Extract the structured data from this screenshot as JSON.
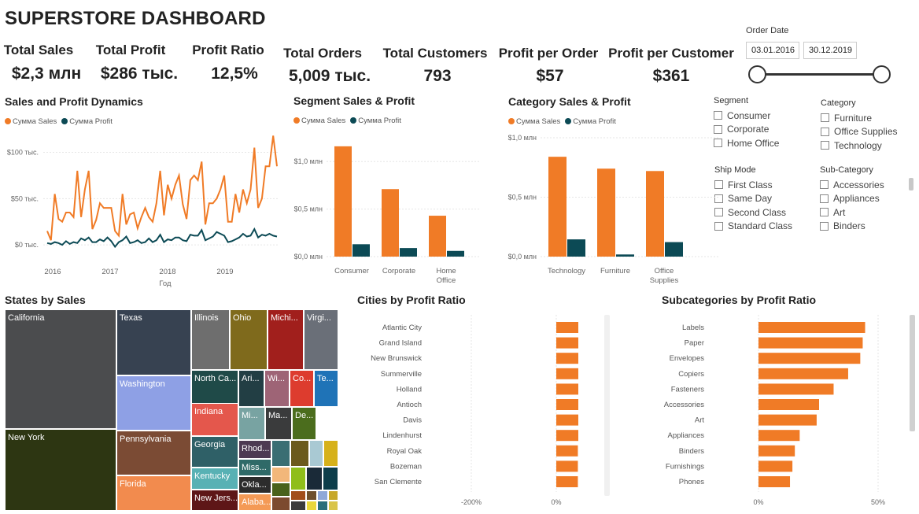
{
  "title": "SUPERSTORE DASHBOARD",
  "kpis": [
    {
      "label": "Total Sales",
      "value": "$2,3 млн"
    },
    {
      "label": "Total Profit",
      "value": "$286 тыс."
    },
    {
      "label": "Profit Ratio",
      "value": "12,5%"
    },
    {
      "label": "Total Orders",
      "value": "5,009 тыс."
    },
    {
      "label": "Total Customers",
      "value": "793"
    },
    {
      "label": "Profit per Order",
      "value": "$57"
    },
    {
      "label": "Profit per Customer",
      "value": "$361"
    }
  ],
  "date_filter": {
    "label": "Order Date",
    "start": "03.01.2016",
    "end": "30.12.2019"
  },
  "slicers": {
    "segment": {
      "title": "Segment",
      "items": [
        "Consumer",
        "Corporate",
        "Home Office"
      ]
    },
    "category": {
      "title": "Category",
      "items": [
        "Furniture",
        "Office Supplies",
        "Technology"
      ]
    },
    "ship_mode": {
      "title": "Ship Mode",
      "items": [
        "First Class",
        "Same Day",
        "Second Class",
        "Standard Class"
      ]
    },
    "sub_category": {
      "title": "Sub-Category",
      "items": [
        "Accessories",
        "Appliances",
        "Art",
        "Binders"
      ]
    }
  },
  "legend": {
    "sales": "Сумма Sales",
    "profit": "Сумма Profit"
  },
  "colors": {
    "sales": "#f07b26",
    "profit": "#0c4a55",
    "grid": "#e6e6e6",
    "axis_text": "#666"
  },
  "chart_data": [
    {
      "title": "Sales and Profit Dynamics",
      "type": "line",
      "xlabel": "Год",
      "x_ticks": [
        "2016",
        "2017",
        "2018",
        "2019"
      ],
      "y_ticks": [
        "$0 тыс.",
        "$50 тыс.",
        "$100 тыс."
      ],
      "ylim": [
        -5,
        120
      ],
      "series": [
        {
          "name": "Сумма Sales",
          "values": [
            15,
            5,
            55,
            28,
            25,
            35,
            35,
            30,
            80,
            30,
            60,
            80,
            17,
            27,
            45,
            40,
            40,
            40,
            15,
            10,
            55,
            22,
            33,
            35,
            18,
            30,
            40,
            30,
            25,
            45,
            80,
            32,
            65,
            50,
            65,
            75,
            44,
            28,
            70,
            75,
            70,
            90,
            22,
            45,
            45,
            50,
            60,
            75,
            25,
            25,
            55,
            35,
            60,
            45,
            60,
            105,
            40,
            50,
            85,
            85,
            118,
            85
          ]
        },
        {
          "name": "Сумма Profit",
          "values": [
            2,
            1,
            3,
            2,
            0,
            4,
            1,
            3,
            2,
            7,
            5,
            8,
            3,
            3,
            6,
            4,
            8,
            4,
            -2,
            3,
            5,
            9,
            2,
            3,
            5,
            2,
            3,
            7,
            3,
            5,
            11,
            3,
            6,
            5,
            8,
            8,
            5,
            4,
            11,
            10,
            10,
            16,
            5,
            7,
            9,
            14,
            12,
            10,
            3,
            4,
            6,
            8,
            12,
            9,
            10,
            17,
            8,
            11,
            10,
            12,
            10,
            9
          ]
        }
      ]
    },
    {
      "title": "Segment Sales & Profit",
      "type": "bar",
      "categories": [
        "Consumer",
        "Corporate",
        "Home Office"
      ],
      "y_ticks": [
        "$0,0 млн",
        "$0,5 млн",
        "$1,0 млн"
      ],
      "ylim": [
        0,
        1.25
      ],
      "series": [
        {
          "name": "Сумма Sales",
          "values": [
            1.16,
            0.71,
            0.43
          ]
        },
        {
          "name": "Сумма Profit",
          "values": [
            0.13,
            0.09,
            0.06
          ]
        }
      ]
    },
    {
      "title": "Category Sales & Profit",
      "type": "bar",
      "categories": [
        "Technology",
        "Furniture",
        "Office Supplies"
      ],
      "y_ticks": [
        "$0,0 млн",
        "$0,5 млн",
        "$1,0 млн"
      ],
      "ylim": [
        0,
        1.0
      ],
      "series": [
        {
          "name": "Сумма Sales",
          "values": [
            0.84,
            0.74,
            0.72
          ]
        },
        {
          "name": "Сумма Profit",
          "values": [
            0.145,
            0.018,
            0.122
          ]
        }
      ]
    },
    {
      "title": "Cities by Profit Ratio",
      "type": "bar",
      "orientation": "horizontal",
      "categories": [
        "Atlantic City",
        "Grand Island",
        "New Brunswick",
        "Summerville",
        "Holland",
        "Antioch",
        "Davis",
        "Lindenhurst",
        "Royal Oak",
        "Bozeman",
        "San Clemente"
      ],
      "x_ticks": [
        "-200%",
        "0%"
      ],
      "values": [
        50,
        50,
        50,
        50,
        50,
        50,
        50,
        50,
        49,
        49,
        49
      ]
    },
    {
      "title": "Subcategories by Profit Ratio",
      "type": "bar",
      "orientation": "horizontal",
      "categories": [
        "Labels",
        "Paper",
        "Envelopes",
        "Copiers",
        "Fasteners",
        "Accessories",
        "Art",
        "Appliances",
        "Binders",
        "Furnishings",
        "Phones"
      ],
      "x_ticks": [
        "0%",
        "50%"
      ],
      "values": [
        44,
        43,
        42,
        37,
        31,
        25,
        24,
        17,
        15,
        14,
        13
      ]
    }
  ],
  "treemap": {
    "title": "States by Sales",
    "cells": [
      {
        "label": "California",
        "color": "#4b4c4e"
      },
      {
        "label": "New York",
        "color": "#2d3612"
      },
      {
        "label": "Texas",
        "color": "#374251"
      },
      {
        "label": "Washington",
        "color": "#8ea0e5"
      },
      {
        "label": "Pennsylvania",
        "color": "#7b4b34"
      },
      {
        "label": "Florida",
        "color": "#f28b4e"
      },
      {
        "label": "Illinois",
        "color": "#6e6e6e"
      },
      {
        "label": "Ohio",
        "color": "#7f6a1c"
      },
      {
        "label": "Michi...",
        "color": "#a11f1c"
      },
      {
        "label": "Virgi...",
        "color": "#6a6f78"
      },
      {
        "label": "North Ca...",
        "color": "#1f4a48"
      },
      {
        "label": "Ari...",
        "color": "#223e44"
      },
      {
        "label": "Wi...",
        "color": "#9e6476"
      },
      {
        "label": "Co...",
        "color": "#dd3c2e"
      },
      {
        "label": "Te...",
        "color": "#1f73b7"
      },
      {
        "label": "Indiana",
        "color": "#e4574c"
      },
      {
        "label": "Mi...",
        "color": "#78a3a2"
      },
      {
        "label": "Ma...",
        "color": "#3a3b3c"
      },
      {
        "label": "De...",
        "color": "#4b6d1d"
      },
      {
        "label": "Georgia",
        "color": "#2f6067"
      },
      {
        "label": "Rhod...",
        "color": "#4d3a52"
      },
      {
        "label": "Kentucky",
        "color": "#58b1b4"
      },
      {
        "label": "Miss...",
        "color": "#2f6a68"
      },
      {
        "label": "New Jers...",
        "color": "#5e1617"
      },
      {
        "label": "Okla...",
        "color": "#2c2c2c"
      },
      {
        "label": "Alaba...",
        "color": "#f49a56"
      }
    ]
  }
}
